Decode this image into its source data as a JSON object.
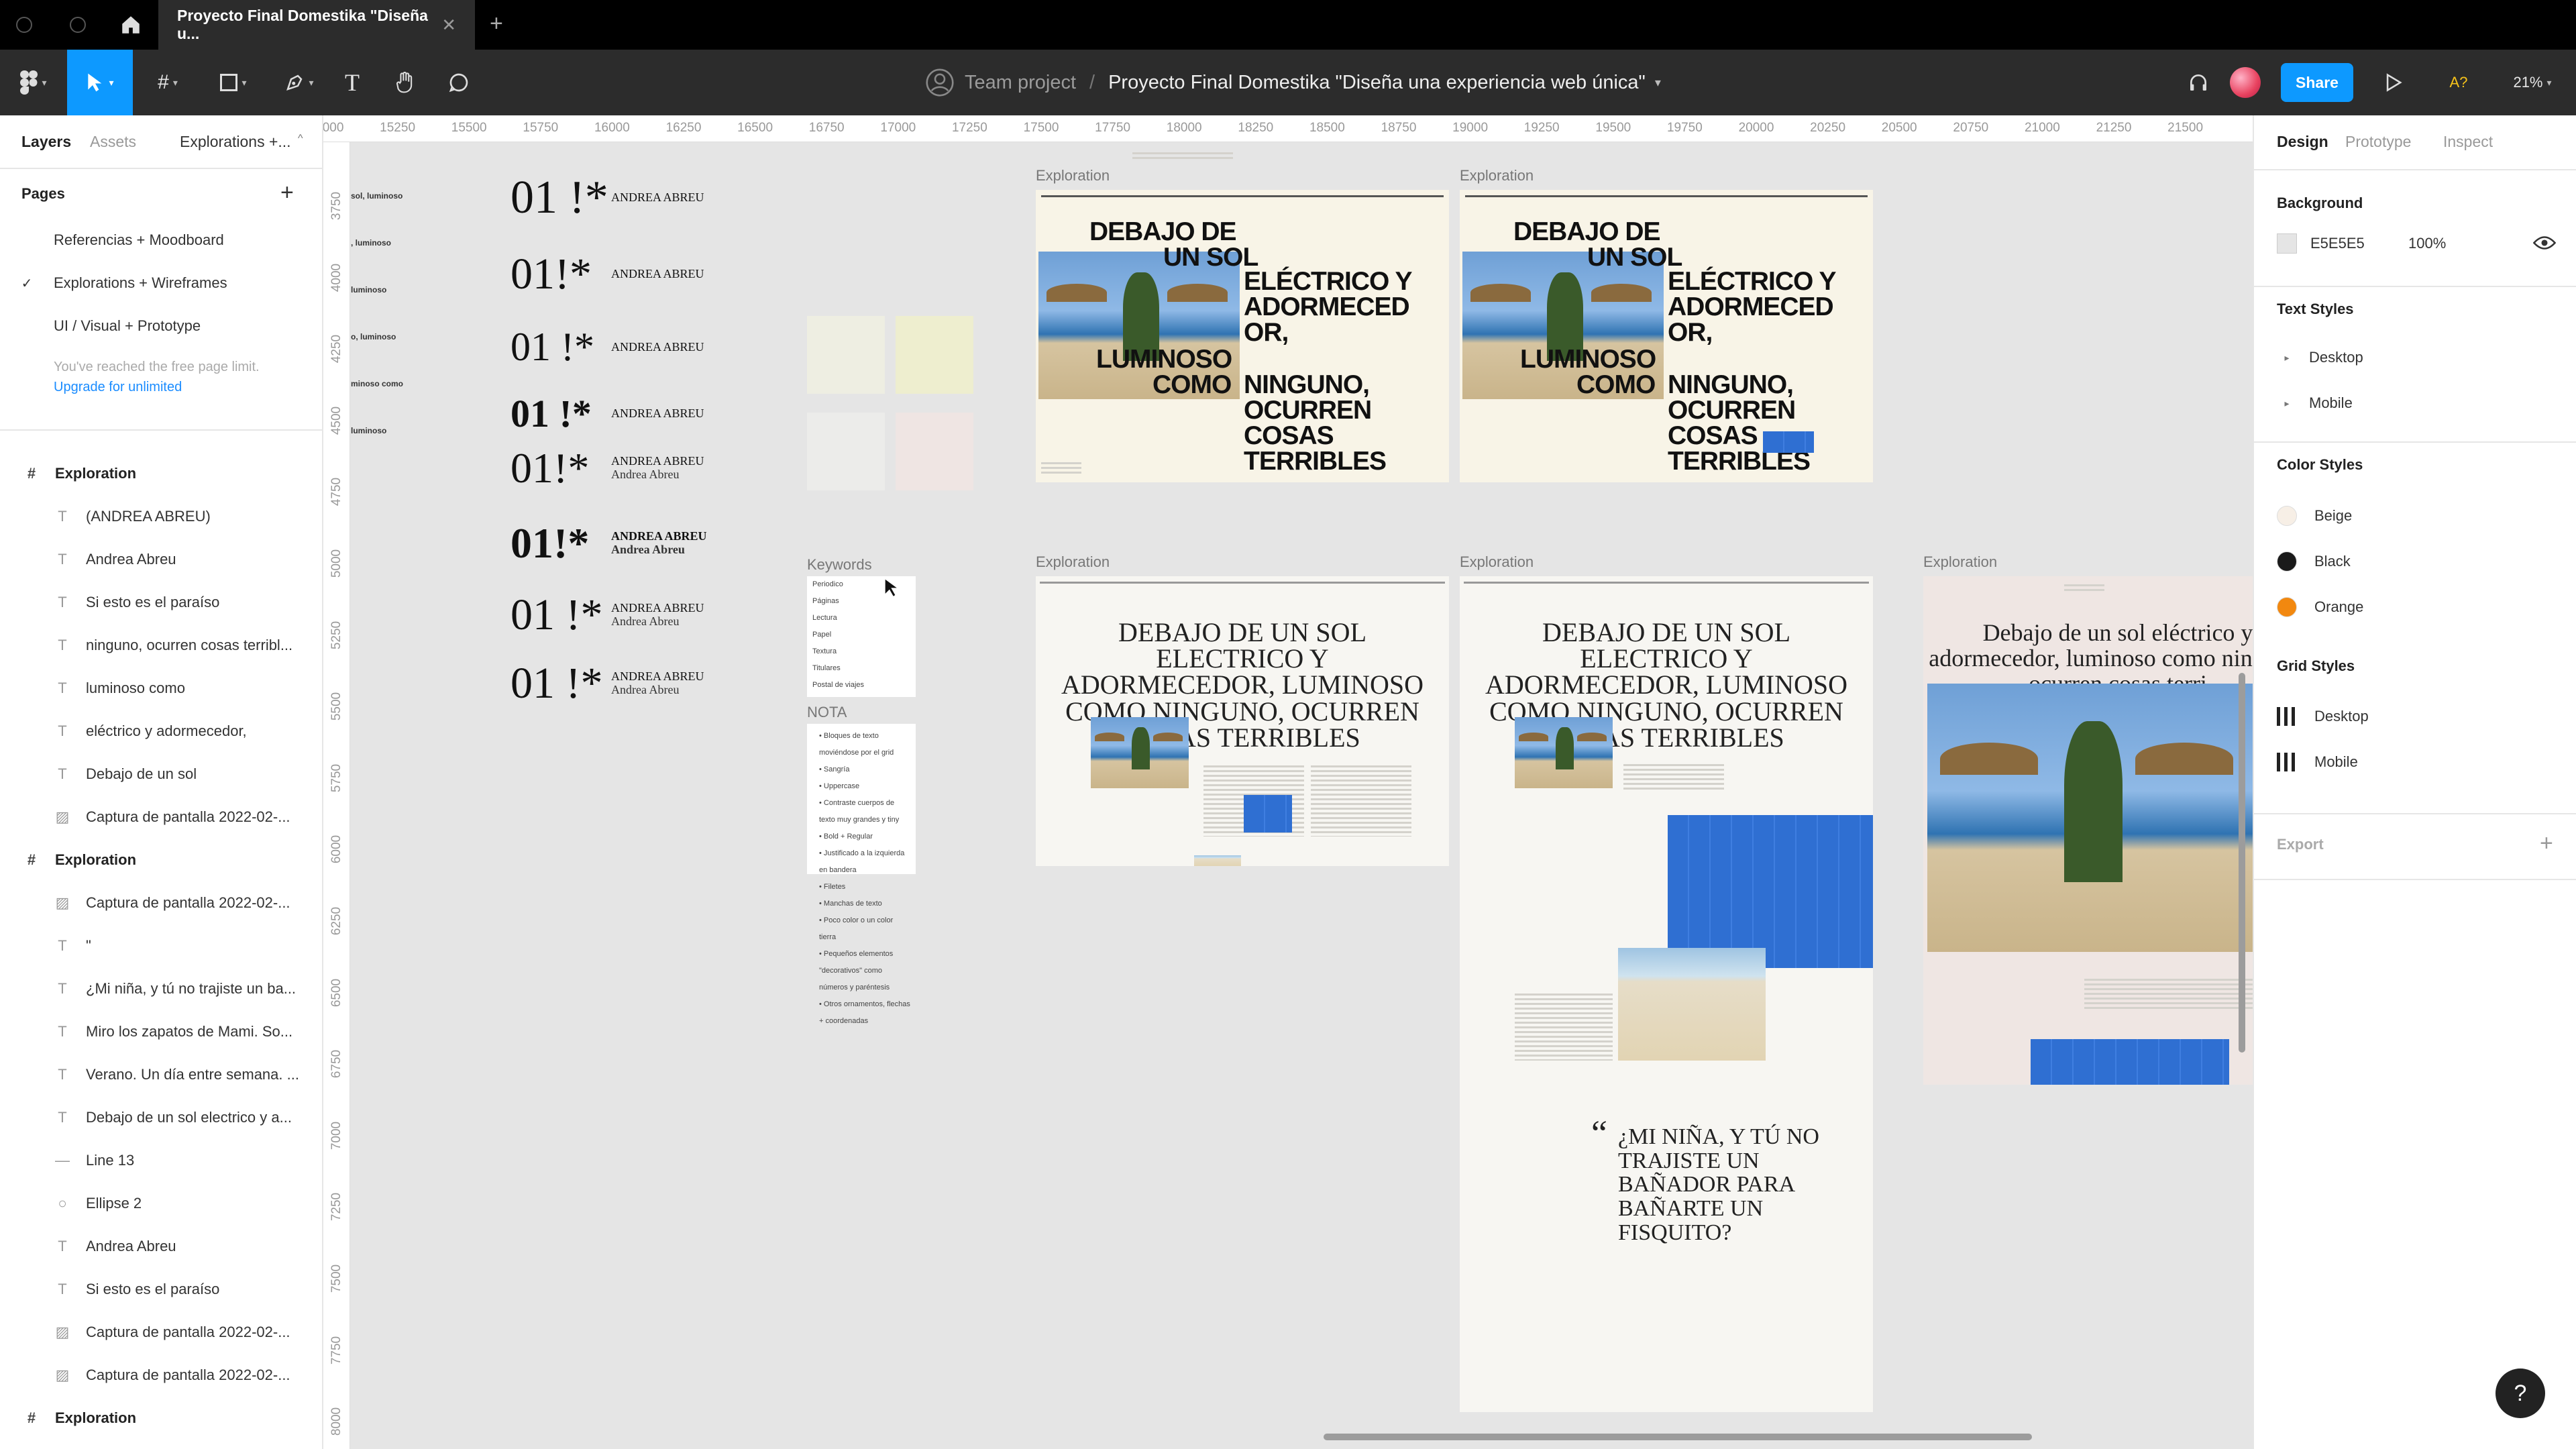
{
  "tab": {
    "title": "Proyecto Final Domestika \"Diseña u...",
    "close": "✕",
    "new": "+"
  },
  "toolbar": {
    "team": "Team project",
    "separator": "/",
    "file": "Proyecto Final Domestika \"Diseña una experiencia web única\"",
    "share": "Share",
    "zoom": "21%",
    "a11y": "A?"
  },
  "left": {
    "tabs": {
      "layers": "Layers",
      "assets": "Assets",
      "page": "Explorations +..."
    },
    "pages_title": "Pages",
    "add": "+",
    "pages": [
      {
        "name": "Referencias + Moodboard",
        "check": ""
      },
      {
        "name": "Explorations + Wireframes",
        "check": "✓"
      },
      {
        "name": "UI / Visual + Prototype",
        "check": ""
      }
    ],
    "limit_note": "You've reached the free page limit.",
    "upgrade": "Upgrade for unlimited",
    "layers": [
      {
        "icon": "#",
        "name": "Exploration",
        "frame": true
      },
      {
        "icon": "T",
        "name": "(ANDREA ABREU)"
      },
      {
        "icon": "T",
        "name": "Andrea Abreu"
      },
      {
        "icon": "T",
        "name": "Si esto es el paraíso"
      },
      {
        "icon": "T",
        "name": "ninguno, ocurren cosas terribl..."
      },
      {
        "icon": "T",
        "name": "luminoso como"
      },
      {
        "icon": "T",
        "name": "eléctrico y adormecedor,"
      },
      {
        "icon": "T",
        "name": "Debajo de un sol"
      },
      {
        "icon": "▨",
        "name": "Captura de pantalla 2022-02-..."
      },
      {
        "icon": "#",
        "name": "Exploration",
        "frame": true
      },
      {
        "icon": "▨",
        "name": "Captura de pantalla 2022-02-..."
      },
      {
        "icon": "T",
        "name": "\""
      },
      {
        "icon": "T",
        "name": "¿Mi niña, y tú no trajiste un ba..."
      },
      {
        "icon": "T",
        "name": "Miro los zapatos de Mami. So..."
      },
      {
        "icon": "T",
        "name": "Verano. Un día entre semana. ..."
      },
      {
        "icon": "T",
        "name": "Debajo de un sol electrico y a..."
      },
      {
        "icon": "—",
        "name": "Line 13"
      },
      {
        "icon": "○",
        "name": "Ellipse 2"
      },
      {
        "icon": "T",
        "name": "Andrea Abreu"
      },
      {
        "icon": "T",
        "name": "Si esto es el paraíso"
      },
      {
        "icon": "▨",
        "name": "Captura de pantalla 2022-02-..."
      },
      {
        "icon": "▨",
        "name": "Captura de pantalla 2022-02-..."
      },
      {
        "icon": "#",
        "name": "Exploration",
        "frame": true
      },
      {
        "icon": "#",
        "name": "Exploration",
        "frame": true
      }
    ]
  },
  "rulers": {
    "top": [
      "15000",
      "15250",
      "15500",
      "15750",
      "16000",
      "16250",
      "16500",
      "16750",
      "17000",
      "17250",
      "17500",
      "17750",
      "18000",
      "18250",
      "18500",
      "18750",
      "19000",
      "19250",
      "19500",
      "19750",
      "20000",
      "20250",
      "20500",
      "20750",
      "21000",
      "21250",
      "21500"
    ],
    "left": [
      "3750",
      "4000",
      "4250",
      "4500",
      "4750",
      "5000",
      "5250",
      "5500",
      "5750",
      "6000",
      "6250",
      "6500",
      "6750",
      "7000",
      "7250",
      "7500",
      "7750",
      "8000"
    ]
  },
  "canvas": {
    "left_snippets": [
      "sol, luminoso",
      ", luminoso",
      "luminoso",
      "o, luminoso",
      "minoso como",
      "luminoso"
    ],
    "type_specimens": [
      {
        "num": "01 !*",
        "name": "ANDREA ABREU",
        "sub": ""
      },
      {
        "num": "01!*",
        "name": "ANDREA ABREU",
        "sub": ""
      },
      {
        "num": "01 !*",
        "name": "ANDREA ABREU",
        "sub": ""
      },
      {
        "num": "01 !*",
        "name": "ANDREA ABREU",
        "sub": ""
      },
      {
        "num": "01!*",
        "name": "ANDREA ABREU",
        "sub": "Andrea Abreu"
      },
      {
        "num": "01!*",
        "name": "ANDREA ABREU",
        "sub": "Andrea Abreu"
      },
      {
        "num": "01 !*",
        "name": "ANDREA ABREU",
        "sub": "Andrea Abreu"
      },
      {
        "num": "01 !*",
        "name": "ANDREA ABREU",
        "sub": "Andrea Abreu"
      }
    ],
    "frame_label": "Exploration",
    "keywords_label": "Keywords",
    "keywords": [
      "Periodico",
      "Páginas",
      "Lectura",
      "Papel",
      "Textura",
      "Titulares",
      "Postal de viajes"
    ],
    "nota_label": "NOTA",
    "nota": [
      "Bloques de texto moviéndose por el grid",
      "Sangría",
      "Uppercase",
      "Contraste cuerpos de texto muy grandes y tiny",
      "Bold + Regular",
      "Justificado a la izquierda en bandera",
      "Filetes",
      "Manchas de texto",
      "Poco color o un color tierra",
      "Pequeños elementos \"decorativos\" como números y paréntesis",
      "Otros ornamentos, flechas + coordenadas"
    ],
    "poster": {
      "l1": "DEBAJO DE",
      "l2": "UN SOL",
      "r1": "ELÉCTRICO Y",
      "r2": "ADORMECED",
      "r3": "OR,",
      "l3": "LUMINOSO",
      "l4": "COMO",
      "r4": "NINGUNO,",
      "r5": "OCURREN",
      "r6": "COSAS",
      "r7": "TERRIBLES"
    },
    "serif_headline": "DEBAJO DE UN SOL ELECTRICO Y ADORMECEDOR, LUMINOSO COMO NINGUNO, OCURREN COSAS TERRIBLES",
    "serif_headline_lc": "Debajo de un sol eléctrico y adormecedor, luminoso como ninguno, ocurren cosas terri",
    "quote_mark": "“",
    "quote": "¿MI NIÑA, Y TÚ NO TRAJISTE UN BAÑADOR PARA BAÑARTE UN FISQUITO?"
  },
  "right": {
    "tabs": {
      "design": "Design",
      "prototype": "Prototype",
      "inspect": "Inspect"
    },
    "background_title": "Background",
    "bg_hex": "E5E5E5",
    "bg_opacity": "100%",
    "text_styles_title": "Text Styles",
    "text_styles": [
      "Desktop",
      "Mobile"
    ],
    "color_styles_title": "Color Styles",
    "colors": [
      {
        "name": "Beige",
        "hex": "#f7efe6"
      },
      {
        "name": "Black",
        "hex": "#1a1a1a"
      },
      {
        "name": "Orange",
        "hex": "#f2880f"
      }
    ],
    "grid_styles_title": "Grid Styles",
    "grid_styles": [
      "Desktop",
      "Mobile"
    ],
    "export_title": "Export",
    "export_add": "+",
    "help": "?"
  }
}
